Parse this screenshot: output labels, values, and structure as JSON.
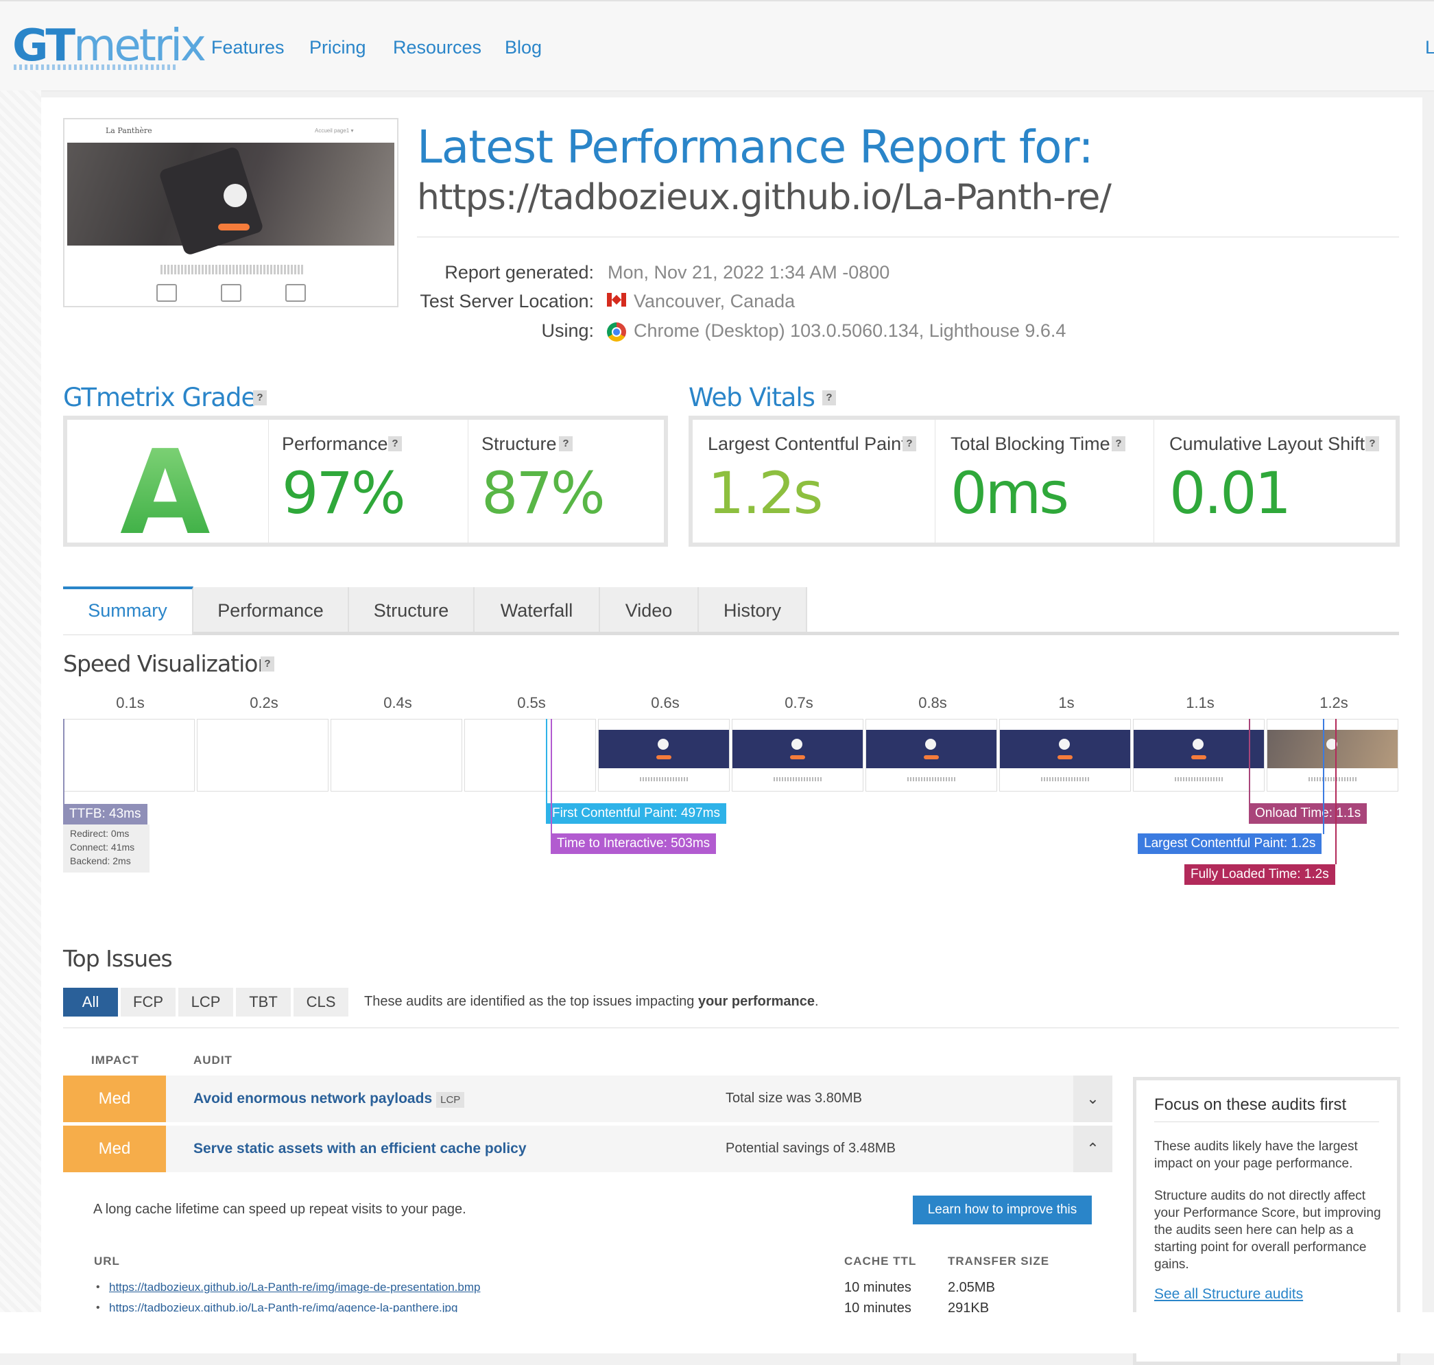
{
  "nav": {
    "logo_gt": "GT",
    "logo_metrix": "metrix",
    "links": [
      "Features",
      "Pricing",
      "Resources",
      "Blog"
    ],
    "right_link": "L"
  },
  "report": {
    "title": "Latest Performance Report for:",
    "url": "https://tadbozieux.github.io/La-Panth-re/",
    "generated_label": "Report generated:",
    "generated_value": "Mon, Nov 21, 2022 1:34 AM -0800",
    "location_label": "Test Server Location:",
    "location_value": "Vancouver, Canada",
    "using_label": "Using:",
    "using_value": "Chrome (Desktop) 103.0.5060.134, Lighthouse 9.6.4"
  },
  "thumbnail": {
    "brand": "La Panthère",
    "menu": "Accueil    page1 ▾"
  },
  "grade": {
    "title": "GTmetrix Grade",
    "letter": "A",
    "performance_label": "Performance",
    "performance_value": "97%",
    "structure_label": "Structure",
    "structure_value": "87%"
  },
  "vitals": {
    "title": "Web Vitals",
    "lcp_label": "Largest Contentful Paint",
    "lcp_value": "1.2s",
    "tbt_label": "Total Blocking Time",
    "tbt_value": "0ms",
    "cls_label": "Cumulative Layout Shift",
    "cls_value": "0.01"
  },
  "help_icon": "?",
  "colors": {
    "accent": "#2a85c9",
    "grade_green": "#2fa83a",
    "med": "#f6ad4a"
  },
  "tabs": [
    "Summary",
    "Performance",
    "Structure",
    "Waterfall",
    "Video",
    "History"
  ],
  "speed": {
    "title": "Speed Visualization",
    "ticks": [
      "0.1s",
      "0.2s",
      "0.4s",
      "0.5s",
      "0.6s",
      "0.7s",
      "0.8s",
      "1s",
      "1.1s",
      "1.2s"
    ],
    "markers": {
      "ttfb": "TTFB: 43ms",
      "redirect": "Redirect: 0ms",
      "connect": "Connect: 41ms",
      "backend": "Backend: 2ms",
      "fcp": "First Contentful Paint: 497ms",
      "tti": "Time to Interactive: 503ms",
      "onload": "Onload Time: 1.1s",
      "lcp": "Largest Contentful Paint: 1.2s",
      "fully": "Fully Loaded Time: 1.2s"
    }
  },
  "issues": {
    "title": "Top Issues",
    "filters": [
      "All",
      "FCP",
      "LCP",
      "TBT",
      "CLS"
    ],
    "desc_prefix": "These audits are identified as the top issues impacting ",
    "desc_bold": "your performance",
    "desc_suffix": ".",
    "col_impact": "IMPACT",
    "col_audit": "AUDIT",
    "rows": [
      {
        "impact": "Med",
        "audit": "Avoid enormous network payloads",
        "tag": "LCP",
        "value": "Total size was 3.80MB",
        "chevron": "⌄"
      },
      {
        "impact": "Med",
        "audit": "Serve static assets with an efficient cache policy",
        "tag": "",
        "value": "Potential savings of 3.48MB",
        "chevron": "⌃"
      }
    ],
    "expanded": {
      "desc": "A long cache lifetime can speed up repeat visits to your page.",
      "learn_button": "Learn how to improve this",
      "col_url": "URL",
      "col_ttl": "CACHE TTL",
      "col_size": "TRANSFER SIZE",
      "entries": [
        {
          "url": "https://tadbozieux.github.io/La-Panth-re/img/image-de-presentation.bmp",
          "ttl": "10 minutes",
          "size": "2.05MB"
        },
        {
          "url": "https://tadbozieux.github.io/La-Panth-re/img/agence-la-panthere.jpg",
          "ttl": "10 minutes",
          "size": "291KB"
        }
      ]
    }
  },
  "focus": {
    "title": "Focus on these audits first",
    "p1": "These audits likely have the largest impact on your page performance.",
    "p2": "Structure audits do not directly affect your Performance Score, but improving the audits seen here can help as a starting point for overall performance gains.",
    "link": "See all Structure audits"
  }
}
